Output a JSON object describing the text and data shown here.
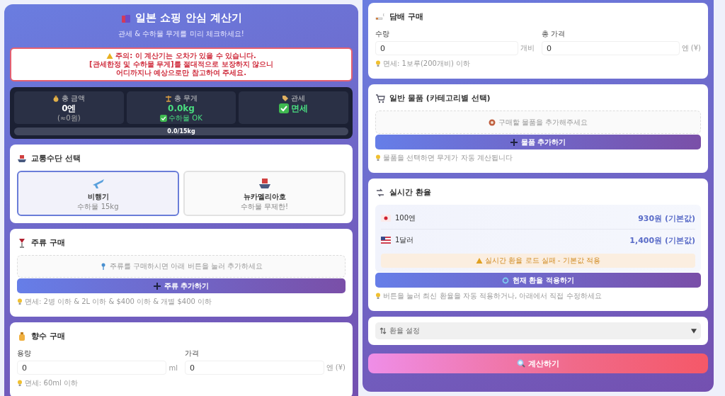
{
  "header": {
    "title": "일본 쇼핑 안심 계산기",
    "subtitle": "관세 & 수하물 무게를 미리 체크하세요!"
  },
  "warning": {
    "lines": [
      "주의: 이 계산기는 오차가 있을 수 있습니다.",
      "[관세한정 및 수하물 무게]를 절대적으로 보장하지 않으니",
      "어디까지나 예상으로만 참고하여 주세요."
    ]
  },
  "summary": {
    "stats": [
      {
        "kind": "amount",
        "label": "총 금액",
        "value": "0엔",
        "note": "(≈0원)"
      },
      {
        "kind": "weight",
        "label": "총 무게",
        "value": "0.0kg",
        "note": "수하물 OK"
      },
      {
        "kind": "duty",
        "label": "관세",
        "value": "면세"
      }
    ],
    "progress": {
      "level": 0,
      "text": "0.0/15kg"
    }
  },
  "transport": {
    "title": "교통수단 선택",
    "options": [
      {
        "kind": "plane",
        "name": "비행기",
        "note": "수하물 15kg",
        "selected": true
      },
      {
        "kind": "ship",
        "name": "뉴카멜리아호",
        "note": "수하물 무제한!",
        "selected": false
      }
    ]
  },
  "liquor": {
    "title": "주류 구매",
    "empty_text": "주류를 구매하시면 아래 버튼을 눌러 추가하세요",
    "add_button": "주류 추가하기",
    "hint": "면세: 2병 이하 & 2L 이하 & $400 이하 & 개별 $400 이하"
  },
  "perfume": {
    "title": "향수 구매",
    "fields": [
      {
        "label": "용량",
        "value": "0",
        "unit": "ml"
      },
      {
        "label": "가격",
        "value": "0",
        "unit": "엔 (¥)"
      }
    ],
    "hint": "면세: 60ml 이하"
  },
  "tobacco": {
    "title": "담배 구매",
    "fields": [
      {
        "label": "수량",
        "value": "0",
        "unit": "개비"
      },
      {
        "label": "총 가격",
        "value": "0",
        "unit": "엔 (¥)"
      }
    ],
    "hint": "면세: 1보루(200개비) 이하"
  },
  "general": {
    "title": "일반 물품 (카테고리별 선택)",
    "empty_text": "구매할 물품을 추가해주세요",
    "add_button": "물품 추가하기",
    "hint": "물품을 선택하면 무게가 자동 계산됩니다"
  },
  "exchange": {
    "title": "실시간 환율",
    "rates": [
      {
        "kind": "jpy",
        "currency": "100엔",
        "value": "930원 (기본값)"
      },
      {
        "kind": "usd",
        "currency": "1달러",
        "value": "1,400원 (기본값)"
      }
    ],
    "alert": "실시간 환율 로드 실패 - 기본값 적용",
    "apply_button": "현재 환율 적용하기",
    "hint": "버튼을 눌러 최신 환율을 자동 적용하거나, 아래에서 직접 수정하세요"
  },
  "settings": {
    "label": "환율 설정",
    "expanded": false
  },
  "calculate_button": "계산하기"
}
